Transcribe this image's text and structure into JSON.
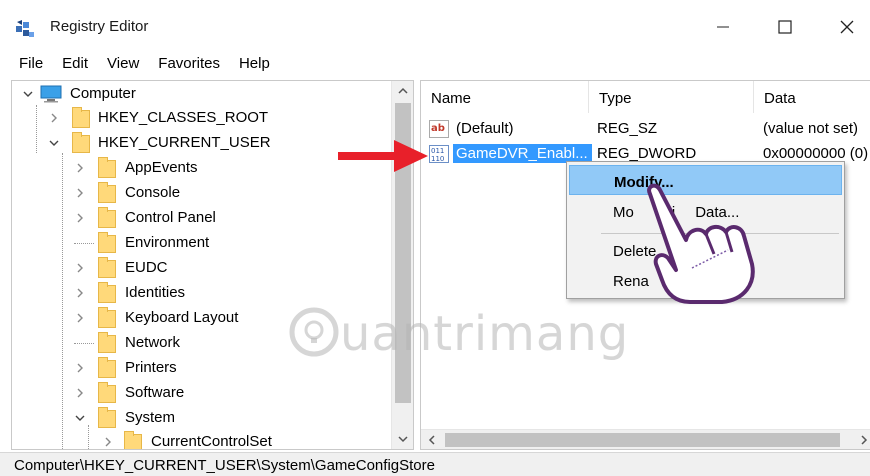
{
  "window": {
    "title": "Registry Editor"
  },
  "menu": [
    "File",
    "Edit",
    "View",
    "Favorites",
    "Help"
  ],
  "tree": {
    "root": "Computer",
    "items": [
      {
        "label": "HKEY_CLASSES_ROOT",
        "expanded": false
      },
      {
        "label": "HKEY_CURRENT_USER",
        "expanded": true
      },
      {
        "label": "AppEvents",
        "expanded": false
      },
      {
        "label": "Console",
        "expanded": false
      },
      {
        "label": "Control Panel",
        "expanded": false
      },
      {
        "label": "Environment",
        "expanded": false
      },
      {
        "label": "EUDC",
        "expanded": false
      },
      {
        "label": "Identities",
        "expanded": false
      },
      {
        "label": "Keyboard Layout",
        "expanded": false
      },
      {
        "label": "Network",
        "expanded": false
      },
      {
        "label": "Printers",
        "expanded": false
      },
      {
        "label": "Software",
        "expanded": false
      },
      {
        "label": "System",
        "expanded": true
      },
      {
        "label": "CurrentControlSet",
        "expanded": false
      }
    ]
  },
  "list": {
    "columns": [
      "Name",
      "Type",
      "Data"
    ],
    "rows": [
      {
        "name": "(Default)",
        "type": "REG_SZ",
        "data": "(value not set)",
        "icon": "string-value-icon"
      },
      {
        "name": "GameDVR_Enabl...",
        "type": "REG_DWORD",
        "data": "0x00000000 (0)",
        "icon": "binary-value-icon"
      }
    ]
  },
  "context_menu": {
    "modify": "Modify...",
    "modify_binary": "Modify Binary Data...",
    "modify_binary_visible": "Mo",
    "modify_binary_tail": "Bi",
    "modify_binary_tail2": "Data...",
    "delete": "Delete",
    "rename": "Rena"
  },
  "status": {
    "path": "Computer\\HKEY_CURRENT_USER\\System\\GameConfigStore"
  },
  "watermark": "uantrimang",
  "colors": {
    "selection": "#3399ff",
    "menu_highlight": "#91c9f7",
    "arrow": "#e8202a",
    "hand_outline": "#5a2a6e"
  }
}
